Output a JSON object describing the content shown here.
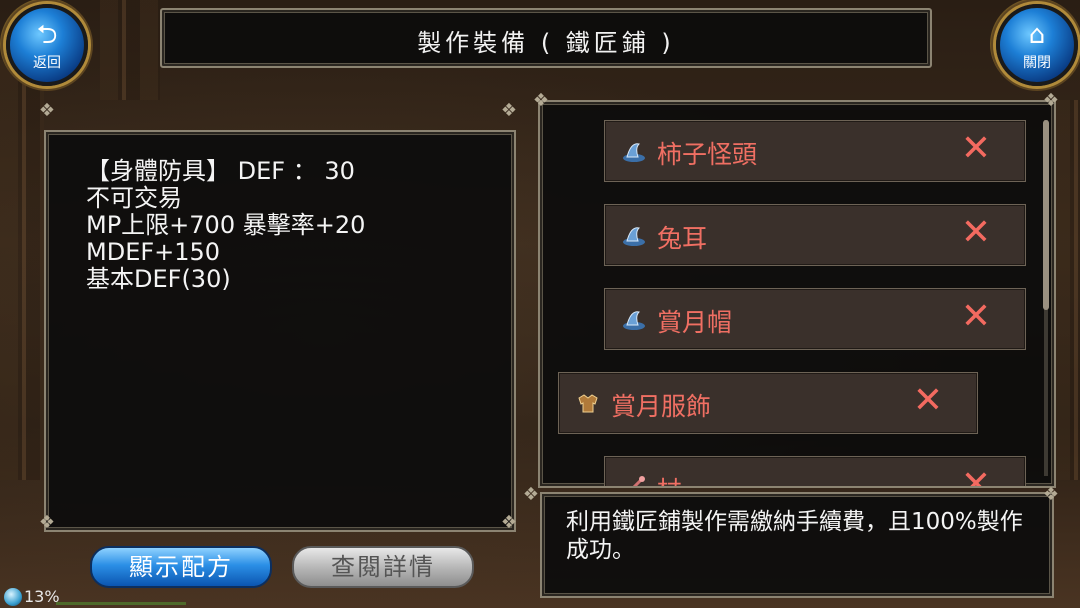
{
  "header": {
    "title": "製作裝備 ( 鐵匠鋪 )",
    "back_label": "返回",
    "close_label": "關閉"
  },
  "info": {
    "lines": "【身體防具】 DEF ： 30\n不可交易\nMP上限+700 暴擊率+20\nMDEF+150\n基本DEF(30)"
  },
  "items": [
    {
      "name": "柿子怪頭",
      "icon": "hat-icon",
      "mark": "✕"
    },
    {
      "name": "兔耳",
      "icon": "hat-icon",
      "mark": "✕"
    },
    {
      "name": "賞月帽",
      "icon": "hat-icon",
      "mark": "✕"
    },
    {
      "name": "賞月服飾",
      "icon": "armor-icon",
      "mark": "✕"
    },
    {
      "name": "杖",
      "icon": "staff-icon",
      "mark": "✕"
    }
  ],
  "description": "利用鐵匠鋪製作需繳納手續費，且100%製作成功。",
  "buttons": {
    "recipe": "顯示配方",
    "detail": "查閱詳情"
  },
  "status": {
    "percent": "13%"
  },
  "colors": {
    "item_name": "#f06f63",
    "accent_blue": "#1d7fd6"
  }
}
